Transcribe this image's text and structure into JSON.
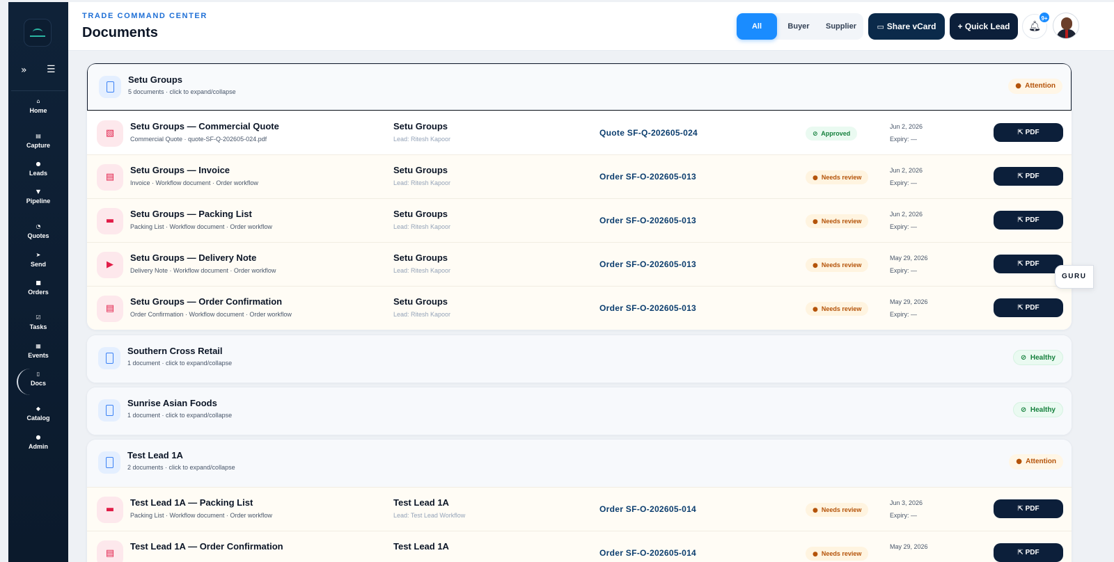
{
  "sidebar": {
    "items": [
      {
        "icon": "home-icon",
        "glyph": "⌂",
        "label": "Home"
      },
      {
        "icon": "capture-icon",
        "glyph": "▤",
        "label": "Capture"
      },
      {
        "icon": "leads-icon",
        "glyph": "●",
        "label": "Leads"
      },
      {
        "icon": "pipeline-icon",
        "glyph": "▼",
        "label": "Pipeline"
      },
      {
        "icon": "quotes-icon",
        "glyph": "◔",
        "label": "Quotes"
      },
      {
        "icon": "send-icon",
        "glyph": "➤",
        "label": "Send"
      },
      {
        "icon": "orders-icon",
        "glyph": "■",
        "label": "Orders"
      },
      {
        "icon": "tasks-icon",
        "glyph": "☑",
        "label": "Tasks"
      },
      {
        "icon": "events-icon",
        "glyph": "▦",
        "label": "Events"
      },
      {
        "icon": "docs-icon",
        "glyph": "▯",
        "label": "Docs"
      },
      {
        "icon": "catalog-icon",
        "glyph": "◆",
        "label": "Catalog"
      },
      {
        "icon": "admin-icon",
        "glyph": "●",
        "label": "Admin"
      }
    ],
    "active": "Docs"
  },
  "header": {
    "subtitle": "TRADE COMMAND CENTER",
    "title": "Documents",
    "filters": [
      "All",
      "Buyer",
      "Supplier"
    ],
    "active_filter": "All",
    "share_label": "Share vCard",
    "quick_lead_label": "+ Quick Lead",
    "notification_count": "9+"
  },
  "groups": [
    {
      "name": "Setu Groups",
      "summary": "5 documents · click to expand/collapse",
      "status": "Attention",
      "rows": [
        {
          "title": "Setu Groups — Commercial Quote",
          "sub": "Commercial Quote · quote-SF-Q-202605-024.pdf",
          "company": "Setu Groups",
          "lead": "Lead: Ritesh Kapoor",
          "ref": "Quote SF-Q-202605-024",
          "status": "Approved",
          "date": "Jun 2, 2026",
          "expiry": "Expiry: —",
          "action": "PDF"
        },
        {
          "title": "Setu Groups — Invoice",
          "sub": "Invoice · Workflow document · Order workflow",
          "company": "Setu Groups",
          "lead": "Lead: Ritesh Kapoor",
          "ref": "Order SF-O-202605-013",
          "status": "Needs review",
          "date": "Jun 2, 2026",
          "expiry": "Expiry: —",
          "action": "PDF"
        },
        {
          "title": "Setu Groups — Packing List",
          "sub": "Packing List · Workflow document · Order workflow",
          "company": "Setu Groups",
          "lead": "Lead: Ritesh Kapoor",
          "ref": "Order SF-O-202605-013",
          "status": "Needs review",
          "date": "Jun 2, 2026",
          "expiry": "Expiry: —",
          "action": "PDF"
        },
        {
          "title": "Setu Groups — Delivery Note",
          "sub": "Delivery Note · Workflow document · Order workflow",
          "company": "Setu Groups",
          "lead": "Lead: Ritesh Kapoor",
          "ref": "Order SF-O-202605-013",
          "status": "Needs review",
          "date": "May 29, 2026",
          "expiry": "Expiry: —",
          "action": "PDF"
        },
        {
          "title": "Setu Groups — Order Confirmation",
          "sub": "Order Confirmation · Workflow document · Order workflow",
          "company": "Setu Groups",
          "lead": "Lead: Ritesh Kapoor",
          "ref": "Order SF-O-202605-013",
          "status": "Needs review",
          "date": "May 29, 2026",
          "expiry": "Expiry: —",
          "action": "PDF"
        }
      ]
    },
    {
      "name": "Southern Cross Retail",
      "summary": "1 document · click to expand/collapse",
      "status": "Healthy",
      "rows": []
    },
    {
      "name": "Sunrise Asian Foods",
      "summary": "1 document · click to expand/collapse",
      "status": "Healthy",
      "rows": []
    },
    {
      "name": "Test Lead 1A",
      "summary": "2 documents · click to expand/collapse",
      "status": "Attention",
      "rows": [
        {
          "title": "Test Lead 1A — Packing List",
          "sub": "Packing List · Workflow document · Order workflow",
          "company": "Test Lead 1A",
          "lead": "Lead: Test Lead Workflow",
          "ref": "Order SF-O-202605-014",
          "status": "Needs review",
          "date": "Jun 3, 2026",
          "expiry": "Expiry: —",
          "action": "PDF"
        },
        {
          "title": "Test Lead 1A — Order Confirmation",
          "sub": "",
          "company": "Test Lead 1A",
          "lead": "",
          "ref": "Order SF-O-202605-014",
          "status": "Needs review",
          "date": "May 29, 2026",
          "expiry": "",
          "action": "PDF"
        }
      ]
    }
  ],
  "guru_label": "GURU",
  "colors": {
    "accent": "#1a8cff",
    "navy": "#0c1f3a",
    "attention": "#b45309",
    "healthy": "#15803d"
  }
}
